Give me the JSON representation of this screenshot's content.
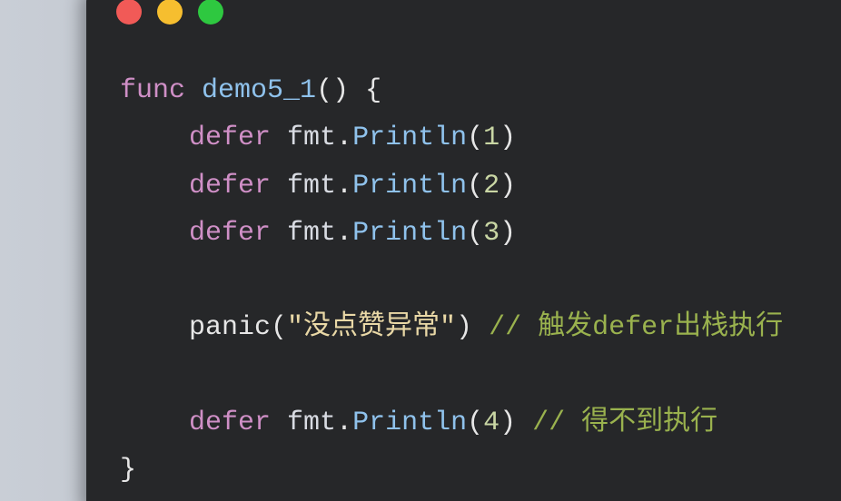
{
  "window": {
    "traffic_lights": {
      "close_color": "#f15a57",
      "minimize_color": "#f6be2f",
      "zoom_color": "#2ec840"
    }
  },
  "code": {
    "line1": {
      "kw": "func",
      "name": "demo5_1",
      "rest": "() {"
    },
    "line2": {
      "kw": "defer",
      "pkg": "fmt",
      "dot": ".",
      "fn": "Println",
      "open": "(",
      "arg": "1",
      "close": ")"
    },
    "line3": {
      "kw": "defer",
      "pkg": "fmt",
      "dot": ".",
      "fn": "Println",
      "open": "(",
      "arg": "2",
      "close": ")"
    },
    "line4": {
      "kw": "defer",
      "pkg": "fmt",
      "dot": ".",
      "fn": "Println",
      "open": "(",
      "arg": "3",
      "close": ")"
    },
    "line6": {
      "fn": "panic",
      "open": "(",
      "str": "\"没点赞异常\"",
      "close": ")",
      "comment": "// 触发defer出栈执行"
    },
    "line8": {
      "kw": "defer",
      "pkg": "fmt",
      "dot": ".",
      "fn": "Println",
      "open": "(",
      "arg": "4",
      "close": ")",
      "comment": "// 得不到执行"
    },
    "line9": {
      "brace": "}"
    }
  }
}
